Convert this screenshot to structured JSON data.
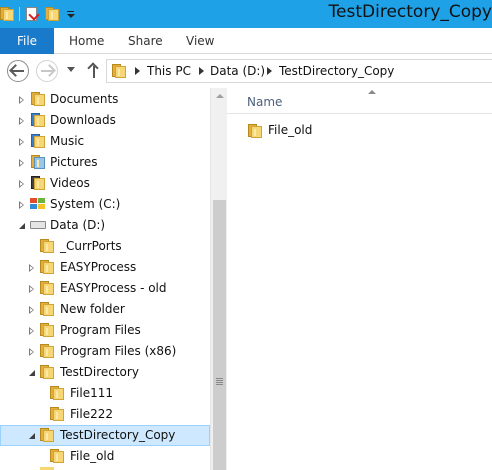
{
  "window": {
    "title": "TestDirectory_Copy"
  },
  "ribbon": {
    "tabs": [
      {
        "label": "File",
        "active": true
      },
      {
        "label": "Home"
      },
      {
        "label": "Share"
      },
      {
        "label": "View"
      }
    ]
  },
  "address": {
    "crumbs": [
      "This PC",
      "Data (D:)",
      "TestDirectory_Copy"
    ]
  },
  "nav": {
    "items": [
      {
        "label": "Documents",
        "icon": "documents-folder-icon"
      },
      {
        "label": "Downloads",
        "icon": "downloads-folder-icon"
      },
      {
        "label": "Music",
        "icon": "music-folder-icon"
      },
      {
        "label": "Pictures",
        "icon": "pictures-folder-icon"
      },
      {
        "label": "Videos",
        "icon": "videos-folder-icon"
      },
      {
        "label": "System (C:)",
        "icon": "system-drive-icon"
      },
      {
        "label": "Data (D:)",
        "icon": "drive-icon",
        "expanded": true
      },
      {
        "label": "_CurrPorts",
        "icon": "folder-icon"
      },
      {
        "label": "EASYProcess",
        "icon": "folder-icon"
      },
      {
        "label": "EASYProcess - old",
        "icon": "folder-icon"
      },
      {
        "label": "New folder",
        "icon": "folder-icon"
      },
      {
        "label": "Program Files",
        "icon": "folder-icon"
      },
      {
        "label": "Program Files (x86)",
        "icon": "folder-icon"
      },
      {
        "label": "TestDirectory",
        "icon": "folder-icon",
        "expanded": true
      },
      {
        "label": "File111",
        "icon": "folder-icon"
      },
      {
        "label": "File222",
        "icon": "folder-icon"
      },
      {
        "label": "TestDirectory_Copy",
        "icon": "folder-icon",
        "expanded": true,
        "selected": true
      },
      {
        "label": "File_old",
        "icon": "folder-icon"
      }
    ]
  },
  "content": {
    "column_header": "Name",
    "items": [
      {
        "label": "File_old",
        "icon": "folder-icon"
      }
    ]
  },
  "colors": {
    "titlebar": "#1ea1e6",
    "file_tab": "#1979ca",
    "selection": "#cde8ff"
  }
}
